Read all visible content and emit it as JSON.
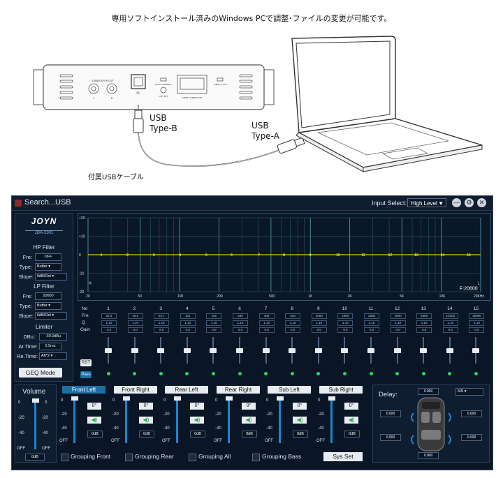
{
  "caption": "専用ソフトインストール済みのWindows PCで調整･ファイルの変更が可能です。",
  "illustration": {
    "usb_b": "USB\nType-B",
    "usb_a": "USB\nType-A",
    "cable": "付属USBケーブル",
    "device_labels": {
      "subwoofer": "SUBWOOFER OUT",
      "pc": "PC",
      "jdyn": "JDYN / NORMAL",
      "reset": "RESET / ACC",
      "connector": "20PIN CONNECTOR",
      "l": "L",
      "r": "R",
      "on_off": "ON / OFF"
    }
  },
  "app": {
    "title": "Search...USB",
    "input_select_label": "Input Select:",
    "input_select_value": "High Level",
    "window_buttons": {
      "minimize": "—",
      "settings": "⚙",
      "close": "✕"
    },
    "logo": {
      "brand": "JOYN",
      "model": "JDA-2301"
    },
    "hp_filter": {
      "title": "HP Filter",
      "fre_label": "Fre:",
      "fre_value": "OFF",
      "type_label": "Type:",
      "type_value": "Butter",
      "slope_label": "Slope:",
      "slope_value": "6dB/Oct"
    },
    "lp_filter": {
      "title": "LP Filter",
      "fre_label": "Fre:",
      "fre_value": "20600",
      "type_label": "Type:",
      "type_value": "Butter",
      "slope_label": "Slope:",
      "slope_value": "6dB/Oct"
    },
    "limiter": {
      "title": "Limiter",
      "dbu_label": "DBu:",
      "dbu_value": "-30.0dBu",
      "at_label": "At.Time:",
      "at_value": "0.5ms",
      "re_label": "Re.Time:",
      "re_value": "Att*2"
    },
    "geq_button": "GEQ Mode",
    "graph": {
      "y_ticks": [
        "+20",
        "+10",
        "0",
        "-10",
        "-20"
      ],
      "x_ticks": [
        "20",
        "50",
        "100",
        "200",
        "500",
        "1K",
        "2K",
        "5K",
        "10K",
        "20KHz"
      ],
      "h_marker": "H",
      "l_marker": "L",
      "freq_readout": "F:20600"
    },
    "band_labels": {
      "no": "No",
      "fre": "Fre",
      "q": "Q",
      "gain": "Gain"
    },
    "bands": [
      {
        "no": "1",
        "fre": "25.3",
        "q": "1.10",
        "gain": "0.0",
        "level": 0.5
      },
      {
        "no": "2",
        "fre": "40.1",
        "q": "1.10",
        "gain": "0.0",
        "level": 0.5
      },
      {
        "no": "3",
        "fre": "63.7",
        "q": "1.10",
        "gain": "0.0",
        "level": 0.5
      },
      {
        "no": "4",
        "fre": "101",
        "q": "1.10",
        "gain": "0.0",
        "level": 0.5
      },
      {
        "no": "5",
        "fre": "161",
        "q": "1.10",
        "gain": "0.0",
        "level": 0.5
      },
      {
        "no": "6",
        "fre": "250",
        "q": "1.10",
        "gain": "0.0",
        "level": 0.5
      },
      {
        "no": "7",
        "fre": "405",
        "q": "1.10",
        "gain": "0.0",
        "level": 0.5
      },
      {
        "no": "8",
        "fre": "630",
        "q": "1.10",
        "gain": "0.0",
        "level": 0.5
      },
      {
        "no": "9",
        "fre": "1000",
        "q": "1.10",
        "gain": "0.0",
        "level": 0.5
      },
      {
        "no": "10",
        "fre": "1600",
        "q": "1.10",
        "gain": "0.0",
        "level": 0.5
      },
      {
        "no": "11",
        "fre": "2500",
        "q": "1.10",
        "gain": "0.0",
        "level": 0.5
      },
      {
        "no": "12",
        "fre": "4000",
        "q": "1.10",
        "gain": "0.0",
        "level": 0.5
      },
      {
        "no": "13",
        "fre": "6350",
        "q": "1.10",
        "gain": "0.0",
        "level": 0.5
      },
      {
        "no": "14",
        "fre": "10100",
        "q": "1.10",
        "gain": "0.0",
        "level": 0.5
      },
      {
        "no": "15",
        "fre": "16000",
        "q": "1.10",
        "gain": "0.0",
        "level": 0.5
      }
    ],
    "rst_button": "RST",
    "pass_button": "Pass",
    "volume": {
      "title": "Volume",
      "scale": [
        "0",
        "-20",
        "-40",
        "OFF"
      ],
      "value": "0dB",
      "level": 1.0
    },
    "channels": [
      {
        "name": "Front Left",
        "active": true,
        "phase": "0°",
        "gain": "0dB",
        "level": 1.0
      },
      {
        "name": "Front Right",
        "active": false,
        "phase": "0°",
        "gain": "0dB",
        "level": 1.0
      },
      {
        "name": "Rear Left",
        "active": false,
        "phase": "0°",
        "gain": "0dB",
        "level": 1.0
      },
      {
        "name": "Rear Right",
        "active": false,
        "phase": "0°",
        "gain": "0dB",
        "level": 1.0
      },
      {
        "name": "Sub Left",
        "active": false,
        "phase": "0°",
        "gain": "0dB",
        "level": 1.0
      },
      {
        "name": "Sub Right",
        "active": false,
        "phase": "0°",
        "gain": "0dB",
        "level": 1.0
      }
    ],
    "channel_scale": [
      "0",
      "-20",
      "-40",
      "OFF"
    ],
    "grouping": [
      "Grouping Front",
      "Grouping Rear",
      "Grouping All",
      "Grouping Bass"
    ],
    "sys_set": "Sys Set",
    "delay": {
      "title": "Delay:",
      "unit": "MS",
      "values": [
        "0.000",
        "0.000",
        "0.000",
        "0.000",
        "0.000",
        "0.000"
      ]
    }
  },
  "colors": {
    "eq_line": "#e8c31c",
    "accent": "#1d6fa3",
    "bg": "#0a1626",
    "led": "#33d05a"
  }
}
